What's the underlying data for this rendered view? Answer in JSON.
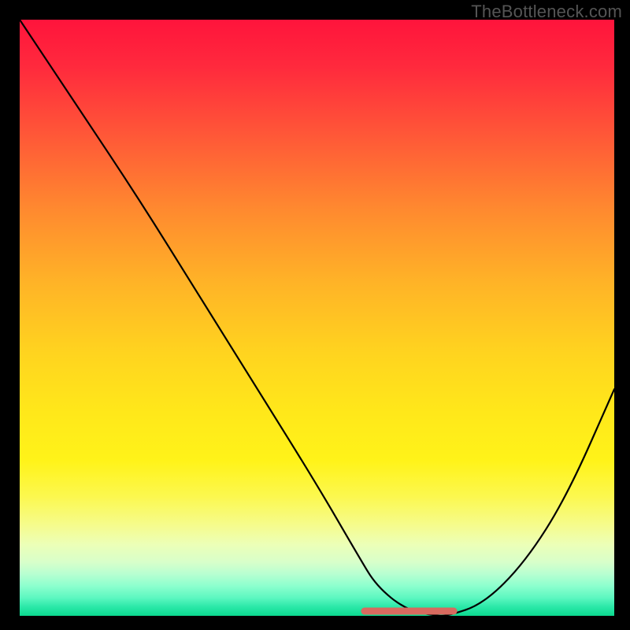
{
  "watermark": "TheBottleneck.com",
  "chart_data": {
    "type": "line",
    "title": "",
    "xlabel": "",
    "ylabel": "",
    "xlim": [
      0,
      100
    ],
    "ylim": [
      0,
      100
    ],
    "grid": false,
    "legend": false,
    "series": [
      {
        "name": "curve",
        "x": [
          0,
          10,
          20,
          30,
          40,
          50,
          57,
          60,
          65,
          70,
          72,
          78,
          85,
          92,
          100
        ],
        "values": [
          100,
          85,
          70,
          54,
          38,
          22,
          10,
          5,
          1,
          0,
          0,
          2,
          9,
          20,
          38
        ]
      }
    ],
    "flat_segment": {
      "x_start": 58,
      "x_end": 73,
      "color": "#d86a5f",
      "thickness": 9
    },
    "gradient_stops": [
      {
        "pos": 0,
        "color": "#ff143c"
      },
      {
        "pos": 50,
        "color": "#ffd41f"
      },
      {
        "pos": 85,
        "color": "#f5fc8f"
      },
      {
        "pos": 100,
        "color": "#0bd98f"
      }
    ]
  }
}
